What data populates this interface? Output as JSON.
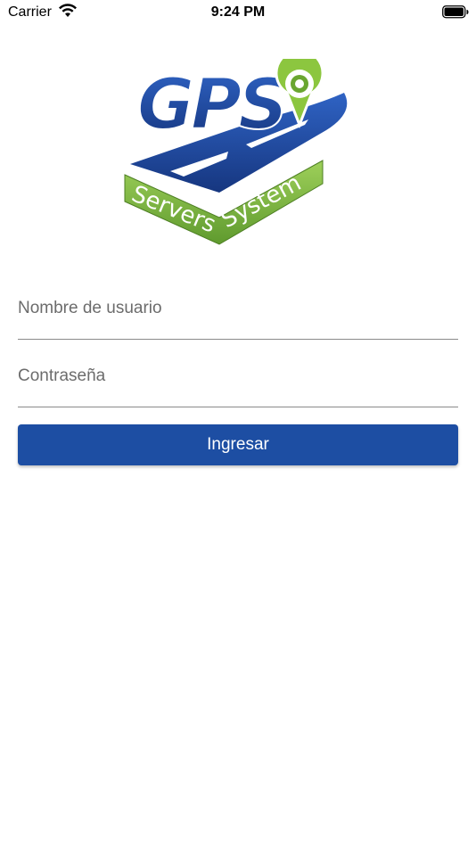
{
  "status_bar": {
    "carrier": "Carrier",
    "time": "9:24 PM",
    "wifi_icon": "wifi-icon",
    "battery_icon": "battery-icon"
  },
  "logo": {
    "big_text": "GPS",
    "ribbon_left": "Servers",
    "ribbon_right": "System",
    "colors": {
      "blue": "#1f4aa6",
      "green": "#7ab648",
      "pin_green": "#8cc63f"
    }
  },
  "login_form": {
    "username_placeholder": "Nombre de usuario",
    "username_value": "",
    "password_placeholder": "Contraseña",
    "password_value": "",
    "submit_label": "Ingresar",
    "button_color": "#1d4ea3"
  }
}
